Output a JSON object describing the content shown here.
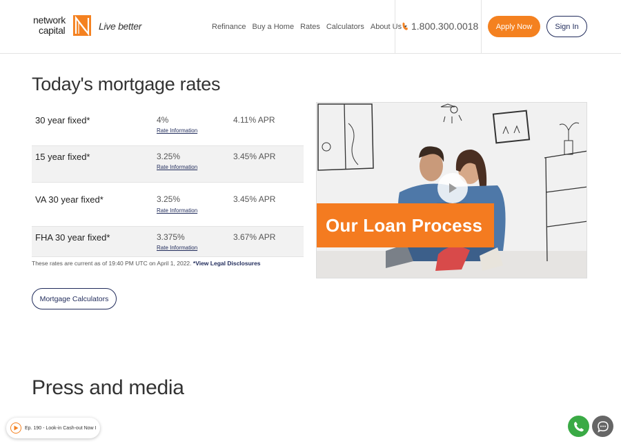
{
  "header": {
    "logo_line1": "network",
    "logo_line2": "capital",
    "tagline": "Live better",
    "nav": [
      "Refinance",
      "Buy a Home",
      "Rates",
      "Calculators",
      "About Us"
    ],
    "phone": "1.800.300.0018",
    "apply_label": "Apply Now",
    "signin_label": "Sign In"
  },
  "rates": {
    "title": "Today's mortgage rates",
    "rows": [
      {
        "name": "30 year fixed*",
        "rate": "4%",
        "info": "Rate Information",
        "apr": "4.11% APR"
      },
      {
        "name": "15 year fixed*",
        "rate": "3.25%",
        "info": "Rate Information",
        "apr": "3.45% APR"
      },
      {
        "name": "VA 30 year fixed*",
        "rate": "3.25%",
        "info": "Rate Information",
        "apr": "3.45% APR"
      },
      {
        "name": "FHA 30 year fixed*",
        "rate": "3.375%",
        "info": "Rate Information",
        "apr": "3.67% APR"
      }
    ],
    "disclaimer": "These rates are current as of 19:40 PM UTC on April 1, 2022.",
    "disclaimer_link": "*View Legal Disclosures",
    "calc_button": "Mortgage Calculators"
  },
  "video": {
    "banner": "Our Loan Process"
  },
  "press": {
    "title": "Press and media"
  },
  "podcast": {
    "text": "Ep. 190 - Look-in Cash-out Now I"
  },
  "colors": {
    "accent": "#f48120",
    "navy": "#1f2a5a",
    "call_green": "#3aaa45"
  },
  "icons": [
    "logo-mark-icon",
    "phone-icon",
    "chevron-down-icon",
    "play-icon",
    "call-icon",
    "chat-icon"
  ]
}
